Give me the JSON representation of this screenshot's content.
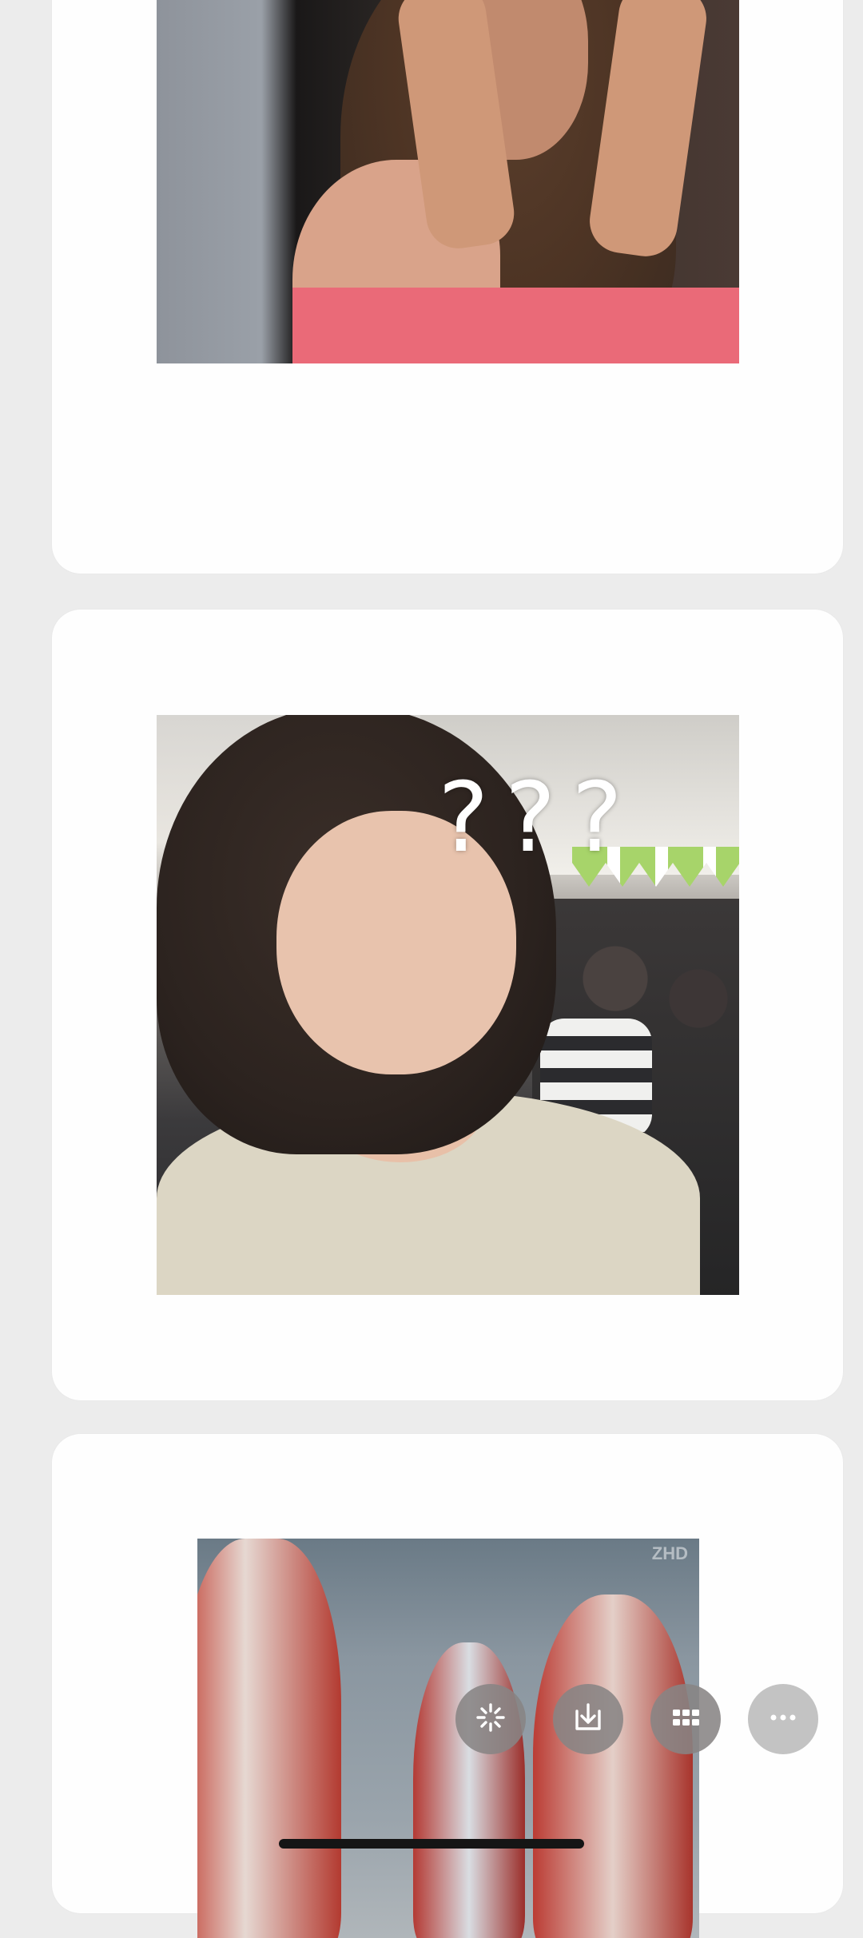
{
  "photos": [
    {
      "name": "meme-woman-holding-face"
    },
    {
      "name": "meme-child-question-marks",
      "caption": "???"
    },
    {
      "name": "meme-ultraman-figures",
      "watermark": "ZHD"
    }
  ],
  "actions": [
    {
      "icon": "sparkle-icon"
    },
    {
      "icon": "download-icon"
    },
    {
      "icon": "grid-icon"
    },
    {
      "icon": "more-icon"
    }
  ]
}
